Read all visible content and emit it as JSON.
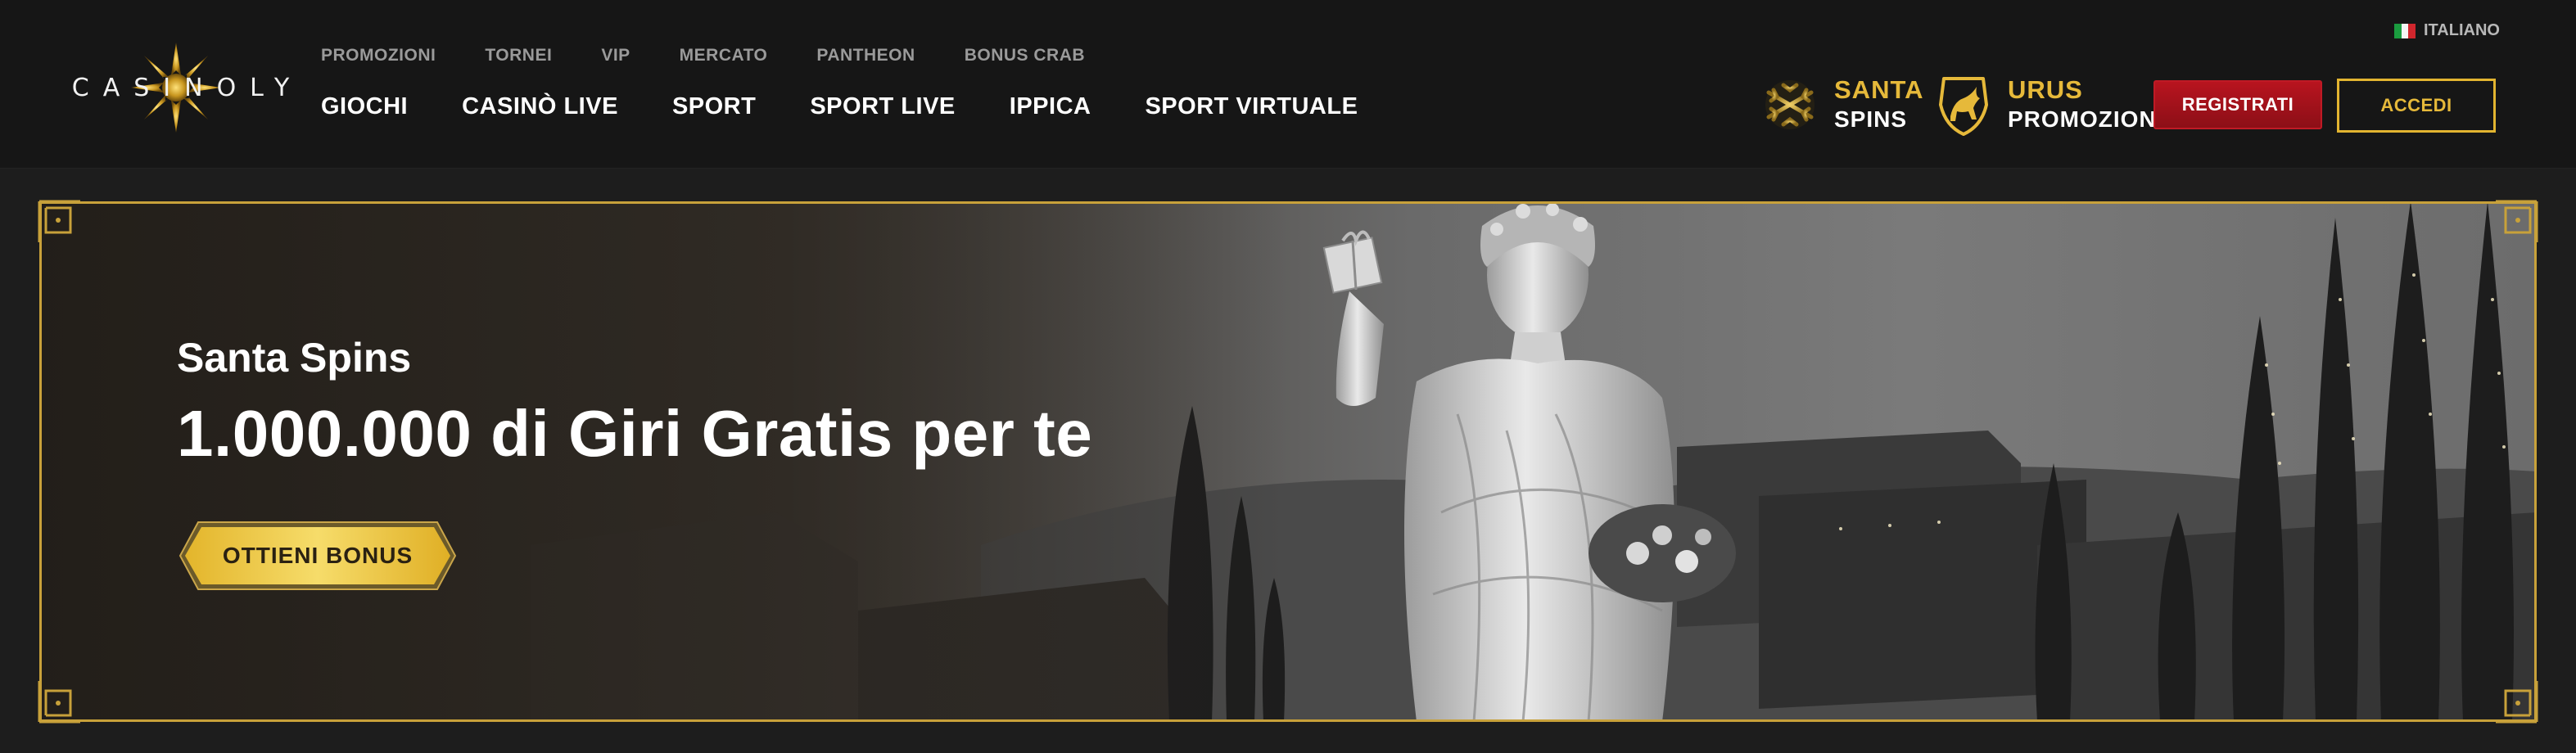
{
  "header": {
    "logo_text": "CASINOLY",
    "subnav": [
      "PROMOZIONI",
      "TORNEI",
      "VIP",
      "MERCATO",
      "PANTHEON",
      "BONUS CRAB"
    ],
    "mainnav": [
      "GIOCHI",
      "CASINÒ LIVE",
      "SPORT",
      "SPORT LIVE",
      "IPPICA",
      "SPORT VIRTUALE"
    ],
    "language": "ITALIANO",
    "promos": {
      "santa": {
        "top": "SANTA",
        "bottom": "SPINS",
        "icon": "snowflake-icon"
      },
      "urus": {
        "top": "URUS",
        "bottom": "PROMOZIONE",
        "icon": "bull-icon"
      }
    },
    "register_label": "REGISTRATI",
    "login_label": "ACCEDI"
  },
  "hero": {
    "subtitle": "Santa Spins",
    "title": "1.000.000 di Giri Gratis per te",
    "cta_label": "OTTIENI BONUS"
  },
  "colors": {
    "gold": "#e6b93a",
    "red": "#b8141f",
    "header_bg": "#161616",
    "page_bg": "#1d1d1d"
  }
}
